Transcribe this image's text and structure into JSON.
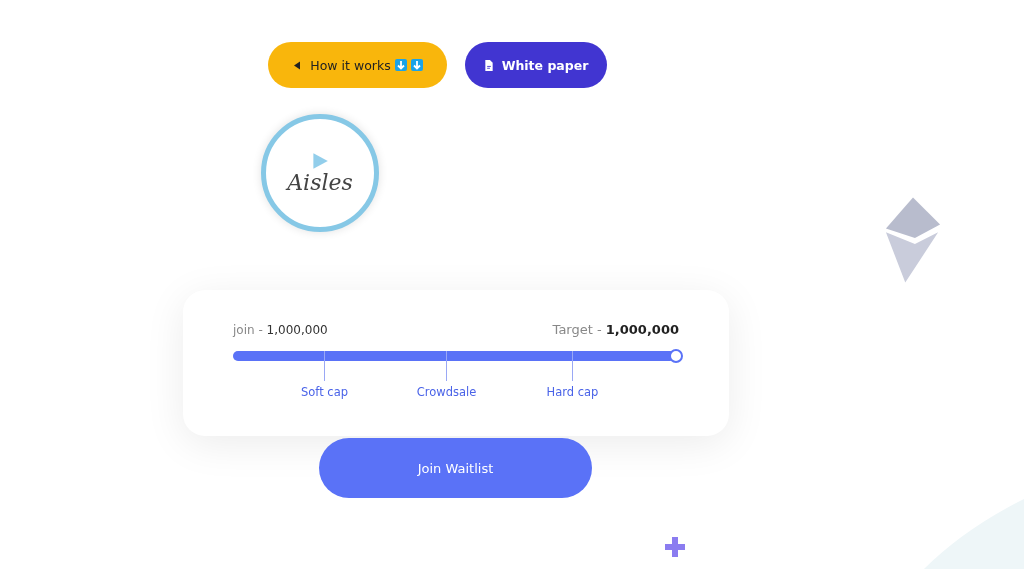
{
  "buttons": [
    {
      "kind": "video",
      "label": "How it works"
    },
    {
      "kind": "document",
      "label": "White paper"
    }
  ],
  "logo": {
    "text": "Aisles"
  },
  "progress": {
    "start_label": "join - ",
    "start_value": "1,000,000",
    "target_label": "Target - ",
    "target_value": "1,000,000",
    "level": 1,
    "milestones": [
      {
        "label": "Soft cap"
      },
      {
        "label": "Crowdsale"
      },
      {
        "label": "Hard cap"
      }
    ]
  },
  "cta": {
    "label": "Join Waitlist"
  }
}
